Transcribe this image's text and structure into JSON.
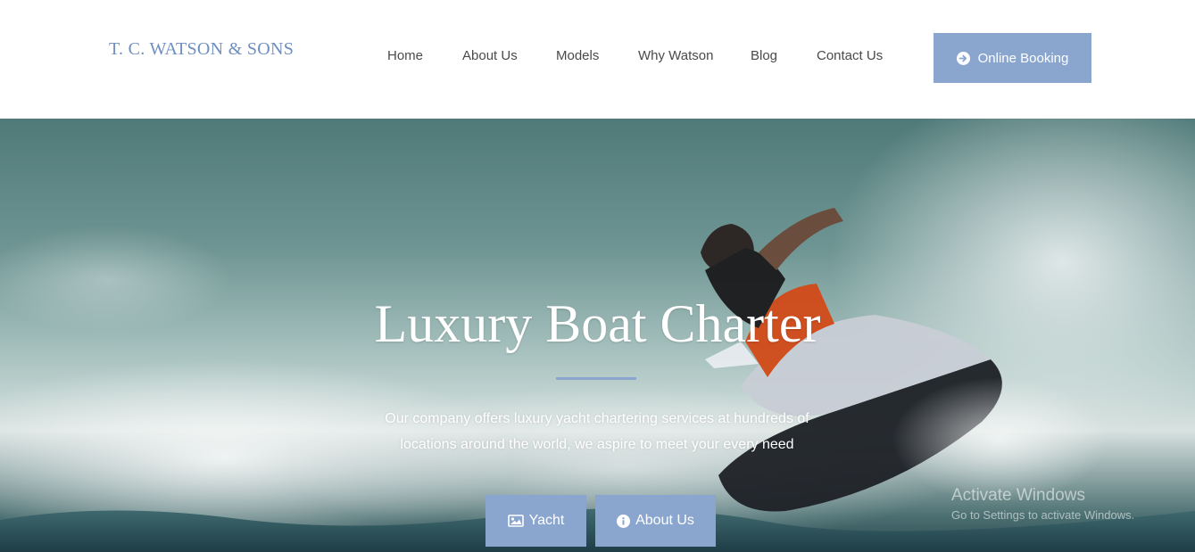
{
  "brand": {
    "logo_text": "T. C. WATSON & SONS"
  },
  "nav": {
    "items": [
      {
        "label": "Home"
      },
      {
        "label": "About Us"
      },
      {
        "label": "Models"
      },
      {
        "label": "Why Watson"
      },
      {
        "label": "Blog"
      },
      {
        "label": "Contact Us"
      }
    ],
    "booking_label": "Online Booking",
    "booking_icon": "circle-arrow-right-icon"
  },
  "hero": {
    "title": "Luxury Boat Charter",
    "description": "Our company offers luxury yacht chartering services at hundreds of locations around the world, we aspire to meet your every need",
    "buttons": [
      {
        "label": "Yacht",
        "icon": "image-icon"
      },
      {
        "label": "About Us",
        "icon": "info-circle-icon"
      }
    ]
  },
  "watermark": {
    "title": "Activate Windows",
    "subtitle": "Go to Settings to activate Windows."
  },
  "colors": {
    "accent": "#8aa6cf",
    "logo": "#6f8fc0",
    "nav_text": "#4a4a4a"
  }
}
